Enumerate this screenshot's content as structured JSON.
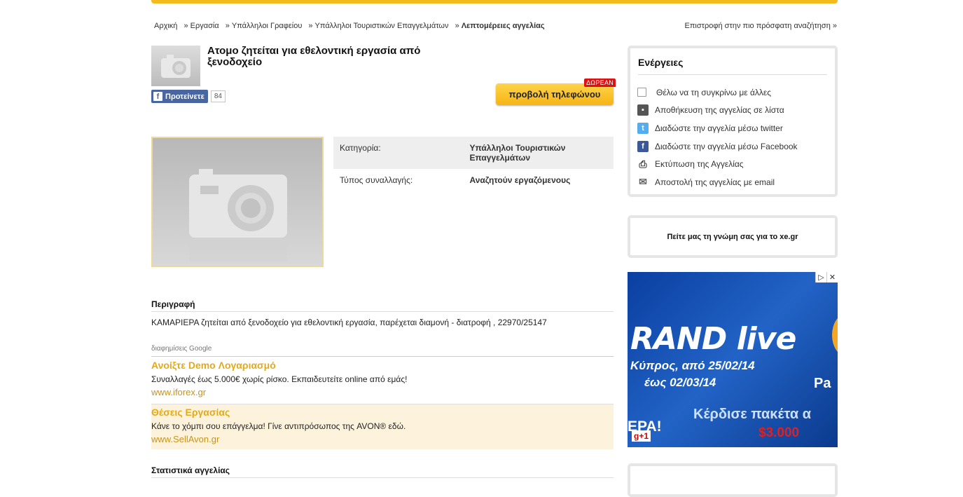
{
  "breadcrumb": {
    "items": [
      "Αρχική",
      "Εργασία",
      "Υπάλληλοι Γραφείου",
      "Υπάλληλοι Τουριστικών Επαγγελμάτων"
    ],
    "separator": "»",
    "current": "Λεπτομέρειες αγγελίας",
    "back_link": "Επιστροφή στην πιο πρόσφατη αναζήτηση »"
  },
  "listing": {
    "title": "Ατομο ζητείται για εθελοντική εργασία από ξενοδοχείο",
    "fb_like_label": "Προτείνετε",
    "fb_count": "84",
    "phone_button": "προβολή τηλεφώνου",
    "free_badge": "ΔΩΡΕΑΝ",
    "details": [
      {
        "label": "Κατηγορία:",
        "value": "Υπάλληλοι Τουριστικών Επαγγελμάτων"
      },
      {
        "label": "Τύπος συναλλαγής:",
        "value": "Αναζητούν εργαζόμενους"
      }
    ],
    "description_title": "Περιγραφή",
    "description": "ΚΑΜΑΡΙΕΡΑ ζητείται από ξενοδοχείο για εθελοντική εργασία, παρέχεται διαμονή - διατροφή , 22970/25147",
    "stats_title": "Στατιστικά αγγελίας"
  },
  "ads": {
    "label": "διαφημίσεις Google",
    "items": [
      {
        "headline": "Ανοίξτε Demo Λογαριασμό",
        "text": "Συναλλαγές έως 5.000€ χωρίς ρίσκο. Εκπαιδευτείτε online από εμάς!",
        "url": "www.iforex.gr"
      },
      {
        "headline": "Θέσεις Εργασίας",
        "text": "Κάνε το χόμπι σου επάγγελμα! Γίνε αντιπρόσωπος της AVON® εδώ.",
        "url": "www.SellAvon.gr"
      }
    ]
  },
  "actions": {
    "title": "Ενέργειες",
    "items": [
      {
        "label": "Θέλω να τη συγκρίνω με άλλες",
        "icon": "checkbox-icon"
      },
      {
        "label": "Αποθήκευση της αγγελίας σε λίστα",
        "icon": "save-icon"
      },
      {
        "label": "Διαδώστε την αγγελία μέσω twitter",
        "icon": "twitter-icon"
      },
      {
        "label": "Διαδώστε την αγγελία μέσω Facebook",
        "icon": "facebook-icon"
      },
      {
        "label": "Εκτύπωση της Αγγελίας",
        "icon": "print-icon"
      },
      {
        "label": "Αποστολή της αγγελίας με email",
        "icon": "email-icon"
      }
    ]
  },
  "feedback": "Πείτε μας τη γνώμη σας για το xe.gr",
  "banner": {
    "line1": "RAND live",
    "line2": "Κύπρος, από 25/02/14",
    "line3": "έως 02/03/14",
    "line4": "Pa",
    "line5": "Κέρδισε πακέτα α",
    "line6": "ΕΡΑ!",
    "line7": "$3.000",
    "gplus": "g+1"
  },
  "colors": {
    "accent": "#f5bb1c",
    "ad_headline": "#e2a91a",
    "ad_highlight": "#fdf3dc",
    "badge": "#dd1111"
  }
}
